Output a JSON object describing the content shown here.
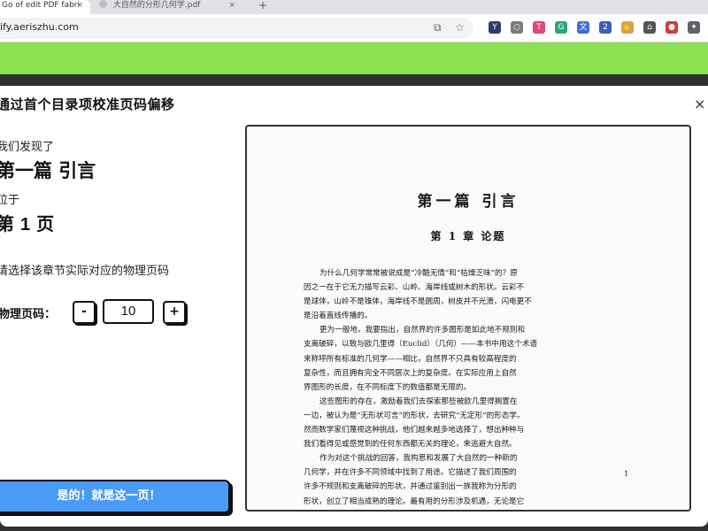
{
  "browser": {
    "tabs": [
      {
        "label": "Go of edit PDF fabri"
      },
      {
        "label": "大自然的分形几何学.pdf"
      }
    ],
    "new_tab": "+",
    "close_glyph": "×",
    "url": "ify.aeriszhu.com",
    "extensions": [
      {
        "name": "y-ext-icon",
        "glyph": "Y",
        "color": "#2a3f6e"
      },
      {
        "name": "circle-ext-icon",
        "glyph": "○",
        "color": "#7a7a7a"
      },
      {
        "name": "t-ext-icon",
        "glyph": "T",
        "color": "#e0457b"
      },
      {
        "name": "g-ext-icon",
        "glyph": "G",
        "color": "#2fa37a"
      },
      {
        "name": "translate-ext-icon",
        "glyph": "文",
        "color": "#3b6fd1"
      },
      {
        "name": "badge-ext-icon",
        "glyph": "2",
        "color": "#3a5bbf"
      },
      {
        "name": "hand-ext-icon",
        "glyph": "✋",
        "color": "#d0a15a"
      },
      {
        "name": "house-ext-icon",
        "glyph": "⌂",
        "color": "#555555"
      },
      {
        "name": "record-ext-icon",
        "glyph": "●",
        "color": "#d33b3b"
      },
      {
        "name": "puzzle-ext-icon",
        "glyph": "✦",
        "color": "#5f6368"
      }
    ]
  },
  "modal": {
    "title": "通过首个目录项校准页码偏移",
    "close": "×",
    "found_prefix": "我们发现了",
    "chapter_name": "第一篇 引言",
    "located_at": "位于",
    "page_label_pre": "第",
    "page_label_num": "1",
    "page_label_post": "页",
    "instruction": "请选择该章节实际对应的物理页码",
    "physical_label": "物理页码：",
    "stepper": {
      "minus": "-",
      "value": "10",
      "plus": "+"
    },
    "confirm_button": "是的！就是这一页！"
  },
  "preview": {
    "title": "第一篇   引言",
    "chapter": "第 1 章   论题",
    "lines": [
      {
        "text": "为什么几何学常常被说成是“冷酷无情”和“枯燥乏味”的？原",
        "indent": true
      },
      {
        "text": "因之一在于它无力描写云彩、山岭、海岸线或树木的形状。云彩不",
        "indent": false
      },
      {
        "text": "是球体，山岭不是锥体，海岸线不是圆周，树皮并不光滑，闪电更不",
        "indent": false
      },
      {
        "text": "是沿着直线传播的。",
        "indent": false
      },
      {
        "text": "更为一般地，我要指出，自然界的许多图形是如此地不规则和",
        "indent": true
      },
      {
        "text": "支离破碎，以致与欧几里得（Euclid）（几何）——本书中用这个术语",
        "indent": false
      },
      {
        "text": "来称呼所有标准的几何学——相比，自然界不只具有较高程度的",
        "indent": false
      },
      {
        "text": "复杂性，而且拥有完全不同层次上的复杂度。在实际应用上自然",
        "indent": false
      },
      {
        "text": "界图形的长度，在不同标度下的数值都是无限的。",
        "indent": false
      },
      {
        "text": "这些图形的存在，激励着我们去探索那些被欧几里得搁置在",
        "indent": true
      },
      {
        "text": "一边，被认为是“无形状可言”的形状，去研究“无定形”的形态学。",
        "indent": false
      },
      {
        "text": "然而数学家们蔑视这种挑战，他们越来越多地选择了，想出种种与",
        "indent": false
      },
      {
        "text": "我们看得见或感觉到的任何东西都无关的理论，来逃避大自然。",
        "indent": false
      },
      {
        "text": "作为对这个挑战的回答，我构思和发展了大自然的一种新的",
        "indent": true
      },
      {
        "text": "几何学，并在许多不同领域中找到了用途。它描述了我们周围的",
        "indent": false
      },
      {
        "text": "许多不规则和支离破碎的形状，并通过鉴别出一族我称为分形的",
        "indent": false
      },
      {
        "text": "形状，创立了相当成熟的理论。最有用的分形涉及机遇，无论是它",
        "indent": false
      },
      {
        "text": "的规则性还是不规则性都是统计意义上的。而且这里所述的形状",
        "indent": false
      },
      {
        "text": "还是趋于有标度的，这意味着其不规则程度和/或支离破碎程度。",
        "indent": false
      }
    ],
    "page_number": "1"
  }
}
